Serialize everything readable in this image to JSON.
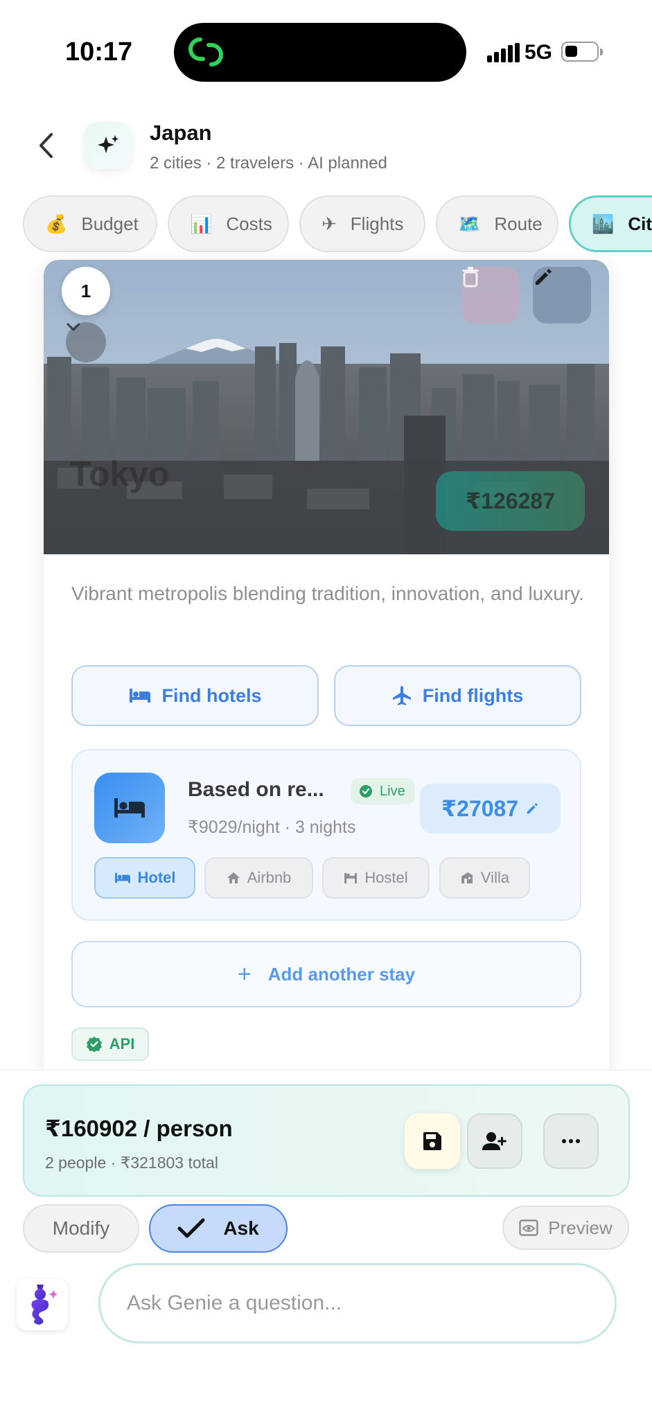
{
  "status_bar": {
    "time": "10:17",
    "network": "5G"
  },
  "header": {
    "title": "Japan",
    "subtitle": "2 cities · 2 travelers · AI planned"
  },
  "tabs": [
    {
      "emoji": "💰",
      "label": "Budget"
    },
    {
      "emoji": "📊",
      "label": "Costs"
    },
    {
      "emoji": "✈",
      "label": "Flights"
    },
    {
      "emoji": "🗺️",
      "label": "Route"
    },
    {
      "emoji": "🏙️",
      "label": "Cities",
      "active": true
    }
  ],
  "city_card": {
    "index": "1",
    "name": "Tokyo",
    "price": "₹126287",
    "description": "Vibrant metropolis blending tradition, innovation, and luxury.",
    "find_hotels_label": "Find hotels",
    "find_flights_label": "Find flights",
    "stay": {
      "title": "Based on re...",
      "live_label": "Live",
      "subtitle": "₹9029/night · 3 nights",
      "price": "₹27087",
      "types": [
        "Hotel",
        "Airbnb",
        "Hostel",
        "Villa"
      ],
      "selected_type": "Hotel"
    },
    "add_stay_label": "Add another stay",
    "source_badge": "API"
  },
  "summary": {
    "per_person": "₹160902 / person",
    "detail": "2 people · ₹321803 total"
  },
  "mode": {
    "modify_label": "Modify",
    "ask_label": "Ask",
    "active": "Ask",
    "preview_label": "Preview"
  },
  "chat": {
    "placeholder": "Ask Genie a question..."
  },
  "colors": {
    "accent_teal": "#62cfc7",
    "accent_blue": "#3e7ee0",
    "live_green": "#2e9d67"
  }
}
